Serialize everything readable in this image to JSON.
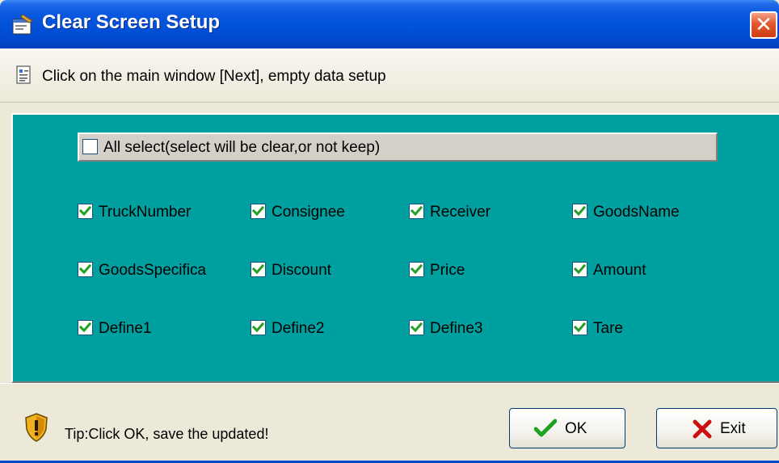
{
  "window": {
    "title": "Clear Screen Setup",
    "close_label": "✕"
  },
  "info": {
    "text": "Click on the main window [Next], empty data setup"
  },
  "all_select": {
    "label": "All select(select will be clear,or not keep)",
    "checked": false
  },
  "fields": [
    {
      "label": "TruckNumber",
      "checked": true
    },
    {
      "label": "Consignee",
      "checked": true
    },
    {
      "label": "Receiver",
      "checked": true
    },
    {
      "label": "GoodsName",
      "checked": true
    },
    {
      "label": "GoodsSpecifica",
      "checked": true
    },
    {
      "label": "Discount",
      "checked": true
    },
    {
      "label": "Price",
      "checked": true
    },
    {
      "label": "Amount",
      "checked": true
    },
    {
      "label": "Define1",
      "checked": true
    },
    {
      "label": "Define2",
      "checked": true
    },
    {
      "label": "Define3",
      "checked": true
    },
    {
      "label": "Tare",
      "checked": true
    }
  ],
  "status": {
    "tip": "Tip:Click OK, save the updated!"
  },
  "buttons": {
    "ok_label": "OK",
    "exit_label": "Exit"
  },
  "colors": {
    "titlebar": "#0050d8",
    "panel": "#00a0a0",
    "check": "#21a121",
    "exit_x": "#cc1010"
  }
}
